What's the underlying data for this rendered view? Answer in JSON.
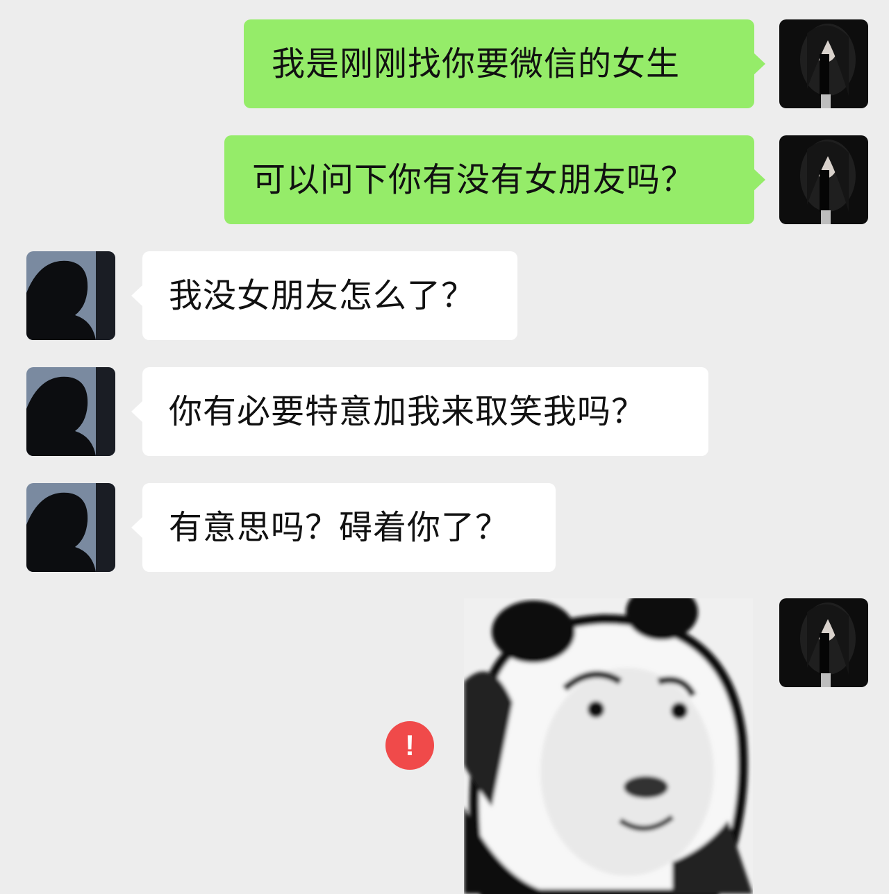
{
  "messages": [
    {
      "direction": "outgoing",
      "text": "我是刚刚找你要微信的女生"
    },
    {
      "direction": "outgoing",
      "text": "可以问下你有没有女朋友吗？"
    },
    {
      "direction": "incoming",
      "text": "我没女朋友怎么了？"
    },
    {
      "direction": "incoming",
      "text": "你有必要特意加我来取笑我吗？"
    },
    {
      "direction": "incoming",
      "text": "有意思吗？碍着你了？"
    },
    {
      "direction": "outgoing",
      "type": "sticker",
      "icon": "panda-face-meme-sticker"
    }
  ],
  "error_badge": {
    "symbol": "!",
    "icon": "send-failed-icon"
  },
  "colors": {
    "background": "#ededed",
    "outgoing_bubble": "#95ec69",
    "incoming_bubble": "#ffffff",
    "error": "#f04a4a"
  }
}
